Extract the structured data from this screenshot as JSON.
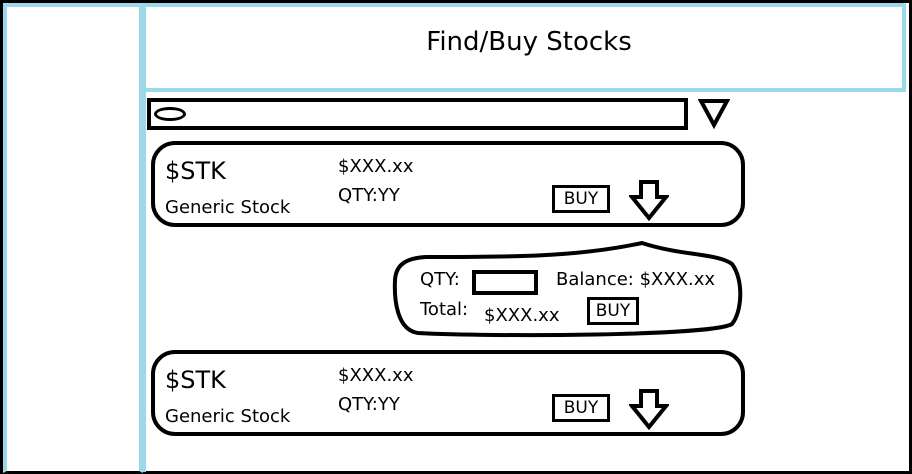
{
  "header": {
    "title": "Find/Buy Stocks"
  },
  "search": {
    "value": "",
    "placeholder": "",
    "icon": "search-icon",
    "filter_icon": "chevron-down-icon"
  },
  "stocks": [
    {
      "symbol": "$STK",
      "name": "Generic Stock",
      "price": "$XXX.xx",
      "qty": "QTY:YY",
      "buy_label": "BUY",
      "expand_icon": "arrow-down-icon"
    },
    {
      "symbol": "$STK",
      "name": "Generic Stock",
      "price": "$XXX.xx",
      "qty": "QTY:YY",
      "buy_label": "BUY",
      "expand_icon": "arrow-down-icon"
    }
  ],
  "buy_panel": {
    "qty_label": "QTY:",
    "qty_value": "",
    "balance": "Balance: $XXX.xx",
    "total_label": "Total:",
    "total_value": "$XXX.xx",
    "buy_label": "BUY"
  },
  "colors": {
    "accent": "#99d9ea",
    "outline": "#000000",
    "background": "#ffffff"
  }
}
